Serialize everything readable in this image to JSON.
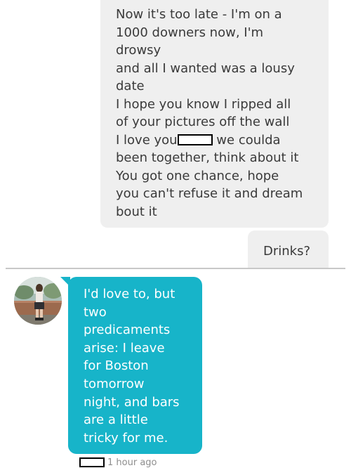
{
  "sent_message_long": {
    "lines": [
      "Now it's too late - I'm on a",
      "1000 downers now, I'm",
      "drowsy",
      "and all I wanted was a lousy",
      "date",
      "I hope you know I ripped all",
      "of your pictures off the wall",
      "I love you",
      " we coulda",
      "been together, think about it",
      "You got one chance, hope",
      "you can't refuse it and dream",
      "bout it"
    ]
  },
  "sent_message_short": {
    "text": "Drinks?"
  },
  "received_message": {
    "lines": [
      "I'd love to, but",
      "two",
      "predicaments",
      "arise: I leave",
      "for Boston",
      "tomorrow",
      "night, and bars",
      "are a little",
      "tricky for me."
    ],
    "timestamp": "1 hour ago"
  },
  "colors": {
    "sent_bubble": "#efefef",
    "received_bubble": "#17b4c9",
    "sent_text": "#3a3a3a",
    "received_text": "#ffffff",
    "timestamp_text": "#8e8e8e"
  }
}
